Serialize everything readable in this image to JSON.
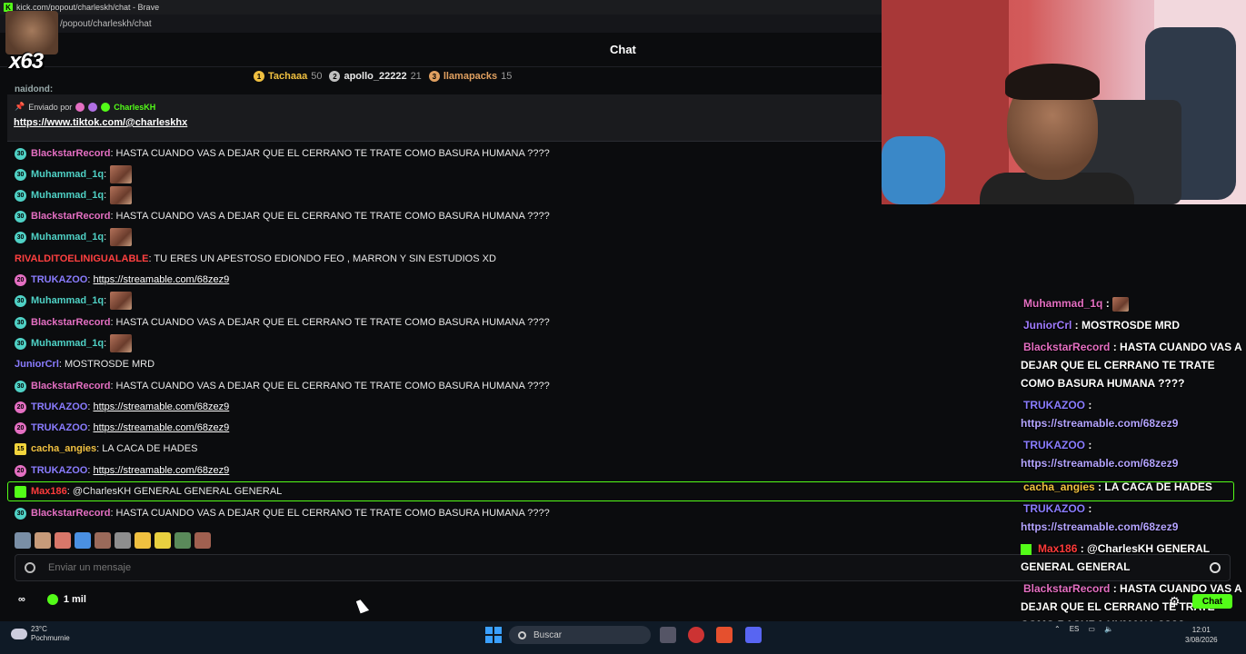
{
  "browser": {
    "title": "kick.com/popout/charleskh/chat - Brave",
    "address": "/popout/charleskh/chat"
  },
  "overlay_badge": {
    "count": "x63"
  },
  "chat": {
    "title": "Chat",
    "leaderboard": [
      {
        "name": "Tachaaa",
        "score": "50",
        "color": "#f0c040"
      },
      {
        "name": "apollo_22222",
        "score": "21",
        "color": "#c0c0c0"
      },
      {
        "name": "llamapacks",
        "score": "15",
        "color": "#e0a060"
      }
    ],
    "partial_top": "naidond:",
    "pinned": {
      "sent_by_label": "Enviado por",
      "author": "CharlesKH",
      "link": "https://www.tiktok.com/@charleskhx"
    },
    "messages": [
      {
        "badge": "30",
        "badge_type": "teal",
        "user": "BlackstarRecord",
        "color": "#e46fc2",
        "text": ": HASTA CUANDO VAS A DEJAR QUE EL CERRANO TE TRATE COMO BASURA HUMANA ????",
        "kind": "text"
      },
      {
        "badge": "30",
        "badge_type": "teal",
        "user": "Muhammad_1q",
        "color": "#4fd1c5",
        "text": ":",
        "kind": "emote"
      },
      {
        "badge": "30",
        "badge_type": "teal",
        "user": "Muhammad_1q",
        "color": "#4fd1c5",
        "text": ":",
        "kind": "emote"
      },
      {
        "badge": "30",
        "badge_type": "teal",
        "user": "BlackstarRecord",
        "color": "#e46fc2",
        "text": ": HASTA CUANDO VAS A DEJAR QUE EL CERRANO TE TRATE COMO BASURA HUMANA ????",
        "kind": "text"
      },
      {
        "badge": "30",
        "badge_type": "teal",
        "user": "Muhammad_1q",
        "color": "#4fd1c5",
        "text": ":",
        "kind": "emote"
      },
      {
        "badge": "",
        "badge_type": "none",
        "user": "RIVALDITOELINIGUALABLE",
        "color": "#ff4040",
        "text": ": TU ERES UN APESTOSO EDIONDO FEO , MARRON Y SIN ESTUDIOS XD",
        "kind": "text"
      },
      {
        "badge": "20",
        "badge_type": "pink",
        "user": "TRUKAZOO",
        "color": "#8a7cff",
        "text": ": ",
        "link": "https://streamable.com/68zez9",
        "kind": "link"
      },
      {
        "badge": "30",
        "badge_type": "teal",
        "user": "Muhammad_1q",
        "color": "#4fd1c5",
        "text": ":",
        "kind": "emote"
      },
      {
        "badge": "30",
        "badge_type": "teal",
        "user": "BlackstarRecord",
        "color": "#e46fc2",
        "text": ": HASTA CUANDO VAS A DEJAR QUE EL CERRANO TE TRATE COMO BASURA HUMANA ????",
        "kind": "text"
      },
      {
        "badge": "30",
        "badge_type": "teal",
        "user": "Muhammad_1q",
        "color": "#4fd1c5",
        "text": ":",
        "kind": "emote"
      },
      {
        "badge": "",
        "badge_type": "none",
        "user": "JuniorCrl",
        "color": "#8a7cff",
        "text": ": MOSTROSDE MRD",
        "kind": "text"
      },
      {
        "badge": "30",
        "badge_type": "teal",
        "user": "BlackstarRecord",
        "color": "#e46fc2",
        "text": ": HASTA CUANDO VAS A DEJAR QUE EL CERRANO TE TRATE COMO BASURA HUMANA ????",
        "kind": "text"
      },
      {
        "badge": "20",
        "badge_type": "pink",
        "user": "TRUKAZOO",
        "color": "#8a7cff",
        "text": ": ",
        "link": "https://streamable.com/68zez9",
        "kind": "link"
      },
      {
        "badge": "20",
        "badge_type": "pink",
        "user": "TRUKAZOO",
        "color": "#8a7cff",
        "text": ": ",
        "link": "https://streamable.com/68zez9",
        "kind": "link"
      },
      {
        "badge": "15",
        "badge_type": "yellow",
        "user": "cacha_angies",
        "color": "#f0c040",
        "text": ": LA CACA DE HADES",
        "kind": "text"
      },
      {
        "badge": "20",
        "badge_type": "pink",
        "user": "TRUKAZOO",
        "color": "#8a7cff",
        "text": ": ",
        "link": "https://streamable.com/68zez9",
        "kind": "link"
      },
      {
        "badge": "",
        "badge_type": "green",
        "user": "Max186",
        "color": "#ff3b3b",
        "text": ": @CharlesKH GENERAL GENERAL GENERAL",
        "kind": "text"
      },
      {
        "badge": "30",
        "badge_type": "teal",
        "user": "BlackstarRecord",
        "color": "#e46fc2",
        "text": ": HASTA CUANDO VAS A DEJAR QUE EL CERRANO TE TRATE COMO BASURA HUMANA ????",
        "kind": "text"
      }
    ],
    "input_placeholder": "Enviar un mensaje",
    "footer": {
      "infinity": "∞",
      "points": "1 mil"
    }
  },
  "overlay_chat": [
    {
      "user": "Muhammad_1q",
      "color": "#e46fc2",
      "text": " : ",
      "emote": true
    },
    {
      "user": "JuniorCrl",
      "color": "#a07cff",
      "text": " : MOSTROSDE MRD"
    },
    {
      "user": "BlackstarRecord",
      "color": "#e46fc2",
      "text": " : HASTA CUANDO VAS A DEJAR QUE EL CERRANO TE TRATE COMO BASURA HUMANA ????"
    },
    {
      "user": "TRUKAZOO",
      "color": "#8a7cff",
      "text": " : ",
      "link": "https://streamable.com/68zez9"
    },
    {
      "user": "TRUKAZOO",
      "color": "#8a7cff",
      "text": " : ",
      "link": "https://streamable.com/68zez9"
    },
    {
      "user": "cacha_angies",
      "color": "#f0c040",
      "text": " : LA CACA DE HADES"
    },
    {
      "user": "TRUKAZOO",
      "color": "#8a7cff",
      "text": " : ",
      "link": "https://streamable.com/68zez9"
    },
    {
      "user": "Max186",
      "color": "#ff3b3b",
      "text": " : @CharlesKH GENERAL GENERAL GENERAL",
      "badge": true
    },
    {
      "user": "BlackstarRecord",
      "color": "#e46fc2",
      "text": " : HASTA CUANDO VAS A DEJAR QUE EL CERRANO TE TRATE COMO BASURA HUMANA ????"
    }
  ],
  "overlay_chat_button": "Chat",
  "taskbar": {
    "weather_temp": "23°C",
    "weather_desc": "Pochmurnie",
    "search_label": "Buscar",
    "lang": "ES",
    "time": "12:01",
    "date": "3/08/2026"
  }
}
